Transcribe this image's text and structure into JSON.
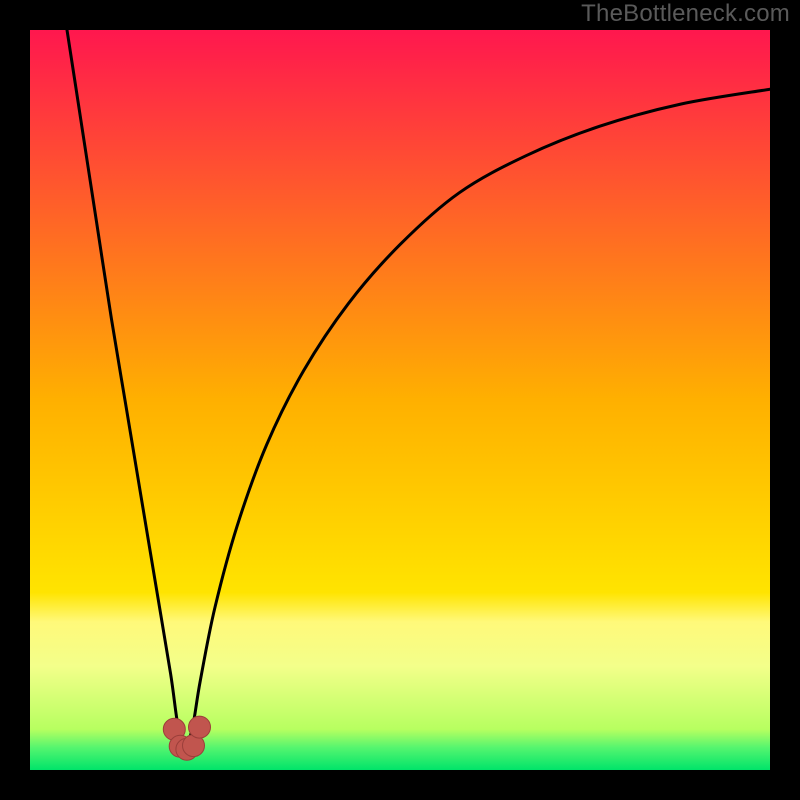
{
  "watermark": "TheBottleneck.com",
  "colors": {
    "frame": "#000000",
    "curve": "#000000",
    "marker_fill": "#c1554e",
    "marker_stroke": "#9b3f3a",
    "gradient_stops": [
      {
        "offset": 0.0,
        "color": "#ff174e"
      },
      {
        "offset": 0.5,
        "color": "#ffb000"
      },
      {
        "offset": 0.76,
        "color": "#ffe400"
      },
      {
        "offset": 0.8,
        "color": "#fff97a"
      },
      {
        "offset": 0.86,
        "color": "#f3ff8a"
      },
      {
        "offset": 0.945,
        "color": "#b7ff60"
      },
      {
        "offset": 0.97,
        "color": "#54f56f"
      },
      {
        "offset": 1.0,
        "color": "#00e46a"
      }
    ]
  },
  "chart_data": {
    "type": "line",
    "title": "",
    "xlabel": "",
    "ylabel": "",
    "xlim": [
      0,
      100
    ],
    "ylim": [
      0,
      100
    ],
    "optimum_x": 21,
    "series": [
      {
        "name": "bottleneck-curve",
        "x": [
          5,
          7,
          9,
          11,
          13,
          15,
          17,
          19,
          20,
          21,
          22,
          23,
          25,
          28,
          32,
          37,
          43,
          50,
          58,
          67,
          77,
          88,
          100
        ],
        "values": [
          100,
          87,
          74,
          61,
          49,
          37,
          25,
          13,
          6,
          3,
          6,
          12,
          22,
          33,
          44,
          54,
          63,
          71,
          78,
          83,
          87,
          90,
          92
        ]
      }
    ],
    "markers": [
      {
        "x": 19.5,
        "y": 5.5
      },
      {
        "x": 20.3,
        "y": 3.2
      },
      {
        "x": 21.2,
        "y": 2.8
      },
      {
        "x": 22.1,
        "y": 3.3
      },
      {
        "x": 22.9,
        "y": 5.8
      }
    ]
  }
}
